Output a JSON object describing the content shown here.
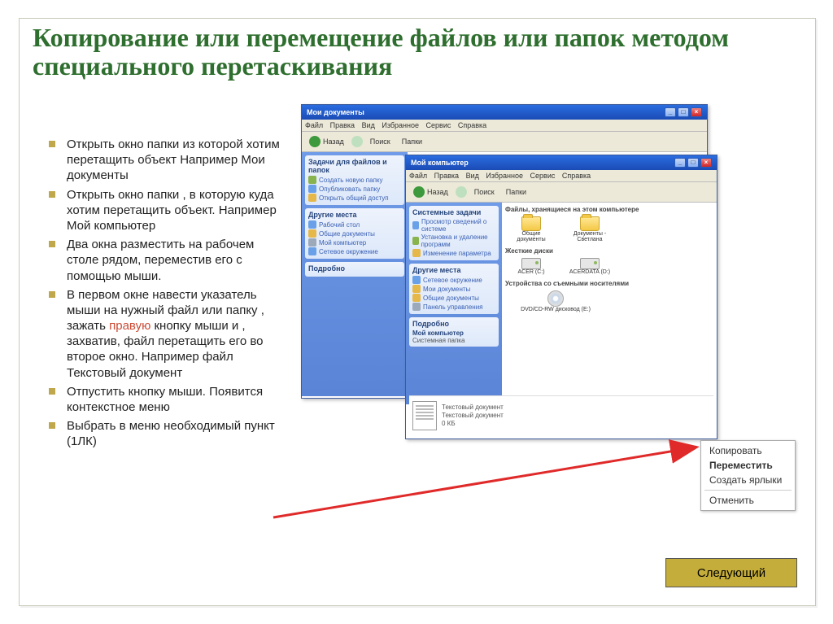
{
  "title": "Копирование или  перемещение файлов или папок методом специального перетаскивания",
  "bullets": {
    "b1": "Открыть окно папки из которой хотим перетащить объект Например Мои документы",
    "b2": "Открыть окно папки , в которую куда хотим перетащить объект. Например Мой компьютер",
    "b3": "Два окна разместить на рабочем столе рядом, переместив его с помощью мыши.",
    "b4a": "В первом окне навести указатель мыши на нужный файл или папку , зажать ",
    "b4_hi": "правую",
    "b4b": " кнопку мыши и , захватив, файл перетащить его во второе окно. Например файл Текстовый документ",
    "b5": "Отпустить кнопку мыши. Появится контекстное меню",
    "b6": "Выбрать в меню необходимый пункт (1ЛК)"
  },
  "win1": {
    "title": "Мои документы",
    "menu": {
      "m1": "Файл",
      "m2": "Правка",
      "m3": "Вид",
      "m4": "Избранное",
      "m5": "Сервис",
      "m6": "Справка"
    },
    "toolbar": {
      "back": "Назад",
      "search": "Поиск",
      "folders": "Папки"
    },
    "side": {
      "p1": "Задачи для файлов и папок",
      "l1": "Создать новую папку",
      "l2": "Опубликовать папку",
      "l3": "Открыть общий доступ",
      "p2": "Другие места",
      "l4": "Рабочий стол",
      "l5": "Общие документы",
      "l6": "Мой компьютер",
      "l7": "Сетевое окружение",
      "p3": "Подробно"
    }
  },
  "win2": {
    "title": "Мой компьютер",
    "menu": {
      "m1": "Файл",
      "m2": "Правка",
      "m3": "Вид",
      "m4": "Избранное",
      "m5": "Сервис",
      "m6": "Справка"
    },
    "toolbar": {
      "back": "Назад",
      "search": "Поиск",
      "folders": "Папки"
    },
    "side": {
      "p1": "Системные задачи",
      "l1": "Просмотр сведений о системе",
      "l2": "Установка и удаление программ",
      "l3": "Изменение параметра",
      "p2": "Другие места",
      "l4": "Сетевое окружение",
      "l5": "Мои документы",
      "l6": "Общие документы",
      "l7": "Панель управления",
      "p3": "Подробно",
      "d1": "Мой компьютер",
      "d2": "Системная папка"
    },
    "content": {
      "h1": "Файлы, хранящиеся на этом компьютере",
      "f1": "Общие документы",
      "f2": "Документы - Светлана",
      "h2": "Жесткие диски",
      "d1": "ACER (C:)",
      "d2": "ACERDATA (D:)",
      "h3": "Устройства со съемными носителями",
      "cd": "DVD/CD-RW дисковод (E:)"
    },
    "doc": {
      "name": "Текстовый документ",
      "type": "Текстовый документ",
      "size": "0 КБ"
    }
  },
  "context": {
    "copy": "Копировать",
    "move": "Переместить",
    "shortcuts": "Создать ярлыки",
    "cancel": "Отменить"
  },
  "next": "Следующий"
}
